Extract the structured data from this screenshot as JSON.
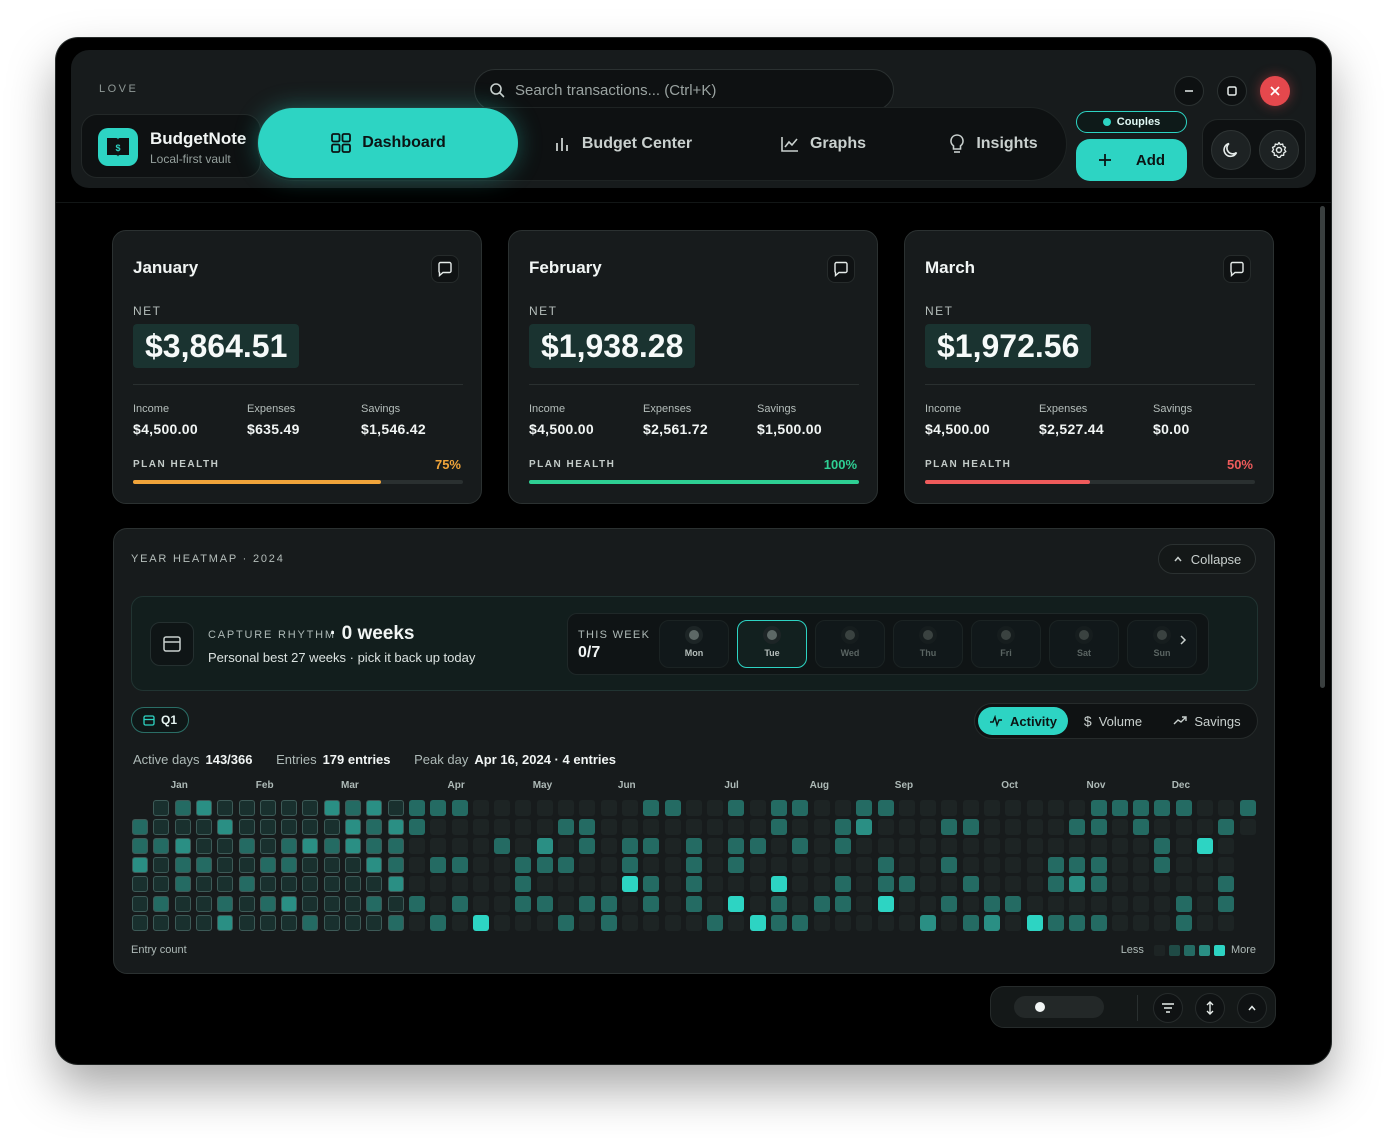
{
  "window": {
    "label": "LOVE"
  },
  "search": {
    "placeholder": "Search transactions... (Ctrl+K)"
  },
  "brand": {
    "name": "BudgetNote",
    "subtitle": "Local-first vault"
  },
  "nav": {
    "tabs": [
      {
        "label": "Dashboard",
        "icon": "grid-icon",
        "active": true
      },
      {
        "label": "Budget Center",
        "icon": "bars-icon"
      },
      {
        "label": "Graphs",
        "icon": "line-chart-icon"
      },
      {
        "label": "Insights",
        "icon": "lightbulb-icon"
      }
    ]
  },
  "mode_badge": "Couples",
  "add_label": "Add",
  "colors": {
    "accent": "#2dd4c3",
    "orange": "#f0a43a",
    "green": "#2ecf93",
    "red": "#ef5b5b",
    "close": "#e5484d"
  },
  "months": [
    {
      "name": "January",
      "net_label": "NET",
      "net": "$3,864.51",
      "income_label": "Income",
      "income": "$4,500.00",
      "expenses_label": "Expenses",
      "expenses": "$635.49",
      "savings_label": "Savings",
      "savings": "$1,546.42",
      "health_label": "PLAN HEALTH",
      "health": "75%",
      "health_value": 0.75,
      "health_color": "#f0a43a"
    },
    {
      "name": "February",
      "net_label": "NET",
      "net": "$1,938.28",
      "income_label": "Income",
      "income": "$4,500.00",
      "expenses_label": "Expenses",
      "expenses": "$2,561.72",
      "savings_label": "Savings",
      "savings": "$1,500.00",
      "health_label": "PLAN HEALTH",
      "health": "100%",
      "health_value": 1.0,
      "health_color": "#2ecf93"
    },
    {
      "name": "March",
      "net_label": "NET",
      "net": "$1,972.56",
      "income_label": "Income",
      "income": "$4,500.00",
      "expenses_label": "Expenses",
      "expenses": "$2,527.44",
      "savings_label": "Savings",
      "savings": "$0.00",
      "health_label": "PLAN HEALTH",
      "health": "50%",
      "health_value": 0.5,
      "health_color": "#ef5b5b"
    }
  ],
  "heatmap": {
    "title": "YEAR HEATMAP · 2024",
    "collapse_label": "Collapse",
    "rhythm": {
      "kicker": "CAPTURE RHYTHM",
      "value": "· 0 weeks",
      "subtitle": "Personal best 27 weeks · pick it back up today"
    },
    "this_week": {
      "label": "THIS WEEK",
      "count": "0/7",
      "days": [
        {
          "label": "Mon",
          "state": "past"
        },
        {
          "label": "Tue",
          "state": "today"
        },
        {
          "label": "Wed",
          "state": "future"
        },
        {
          "label": "Thu",
          "state": "future"
        },
        {
          "label": "Fri",
          "state": "future"
        },
        {
          "label": "Sat",
          "state": "future"
        },
        {
          "label": "Sun",
          "state": "future"
        }
      ]
    },
    "quarter": "Q1",
    "modes": [
      {
        "label": "Activity",
        "icon": "activity-icon",
        "active": true
      },
      {
        "label": "Volume",
        "icon": "dollar-icon"
      },
      {
        "label": "Savings",
        "icon": "trend-up-icon"
      }
    ],
    "stats": {
      "active_days_label": "Active days",
      "active_days": "143/366",
      "entries_label": "Entries",
      "entries": "179 entries",
      "peak_label": "Peak day",
      "peak": "Apr 16, 2024 · 4 entries"
    },
    "month_labels": [
      "Jan",
      "Feb",
      "Mar",
      "Apr",
      "May",
      "Jun",
      "Jul",
      "Aug",
      "Sep",
      "Oct",
      "Nov",
      "Dec"
    ],
    "footer_left": "Entry count",
    "legend_less": "Less",
    "legend_more": "More",
    "scale_colors": [
      "#1d2424",
      "#1f4a45",
      "#246b63",
      "#2a8f84",
      "#2dd4c3"
    ],
    "weeks": 53,
    "q1_weeks": 13,
    "q1_highlight": "#19302e"
  }
}
